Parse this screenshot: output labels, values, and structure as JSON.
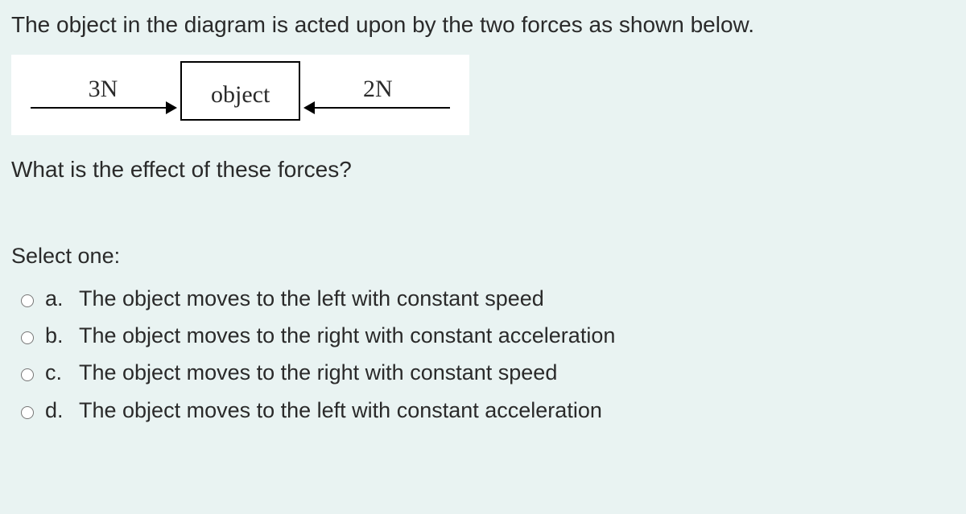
{
  "question": {
    "intro": "The object in the diagram is acted upon by the two forces as shown below.",
    "diagram": {
      "left_force_label": "3N",
      "right_force_label": "2N",
      "object_label": "object"
    },
    "subquestion": "What is the effect of these forces?",
    "select_prompt": "Select one:",
    "options": [
      {
        "letter": "a.",
        "text": "The object moves to the left with constant speed"
      },
      {
        "letter": "b.",
        "text": "The object moves to the right with constant acceleration"
      },
      {
        "letter": "c.",
        "text": "The object moves to the right with constant speed"
      },
      {
        "letter": "d.",
        "text": "The object moves to the left with constant acceleration"
      }
    ]
  }
}
